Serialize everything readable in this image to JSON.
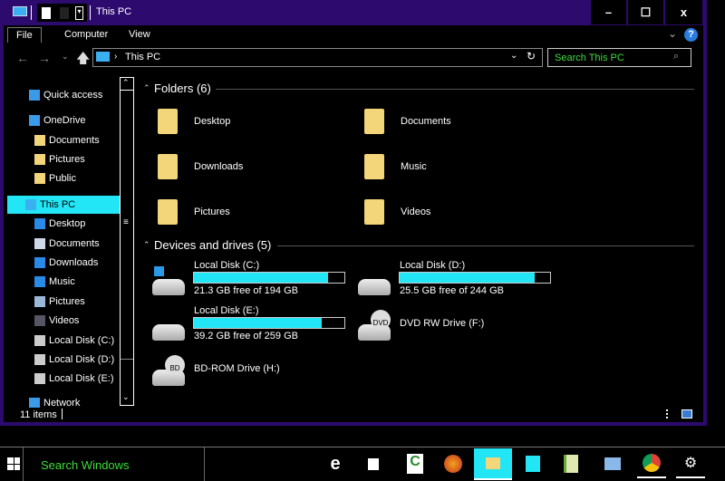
{
  "window": {
    "title": "This PC",
    "minimize": "–",
    "maximize": "☐",
    "close": "x"
  },
  "ribbon": {
    "tabs": [
      "File",
      "Computer",
      "View"
    ],
    "help": "?"
  },
  "address": {
    "path": "This PC",
    "search_placeholder": "Search This PC"
  },
  "nav": {
    "items": [
      {
        "label": "Quick access",
        "icon": "star-icon"
      },
      {
        "label": "OneDrive",
        "icon": "cloud-icon"
      },
      {
        "label": "Documents",
        "icon": "folder-icon"
      },
      {
        "label": "Pictures",
        "icon": "folder-icon"
      },
      {
        "label": "Public",
        "icon": "folder-icon"
      },
      {
        "label": "This PC",
        "icon": "computer-icon",
        "selected": true
      },
      {
        "label": "Desktop",
        "icon": "desktop-icon"
      },
      {
        "label": "Documents",
        "icon": "documents-icon"
      },
      {
        "label": "Downloads",
        "icon": "download-icon"
      },
      {
        "label": "Music",
        "icon": "music-icon"
      },
      {
        "label": "Pictures",
        "icon": "pictures-icon"
      },
      {
        "label": "Videos",
        "icon": "videos-icon"
      },
      {
        "label": "Local Disk (C:)",
        "icon": "drive-icon"
      },
      {
        "label": "Local Disk (D:)",
        "icon": "drive-icon"
      },
      {
        "label": "Local Disk (E:)",
        "icon": "drive-icon"
      },
      {
        "label": "Network",
        "icon": "network-icon"
      }
    ]
  },
  "folders": {
    "header": "Folders (6)",
    "items": [
      "Desktop",
      "Documents",
      "Downloads",
      "Music",
      "Pictures",
      "Videos"
    ]
  },
  "devices": {
    "header": "Devices and drives (5)",
    "drives": [
      {
        "name": "Local Disk (C:)",
        "free": "21.3 GB free of 194 GB",
        "used_fraction": 0.89
      },
      {
        "name": "Local Disk (D:)",
        "free": "25.5 GB free of 244 GB",
        "used_fraction": 0.9
      },
      {
        "name": "Local Disk (E:)",
        "free": "39.2 GB free of 259 GB",
        "used_fraction": 0.85
      },
      {
        "name": "DVD RW Drive (F:)",
        "badge": "DVD"
      },
      {
        "name": "BD-ROM Drive (H:)",
        "badge": "BD"
      }
    ]
  },
  "status": {
    "count": "11 items"
  },
  "taskbar": {
    "search": "Search Windows",
    "edge": "e"
  },
  "colors": {
    "accent": "#22e5f5",
    "frame": "#2d0a6e",
    "search_text": "#3ddc3d"
  }
}
